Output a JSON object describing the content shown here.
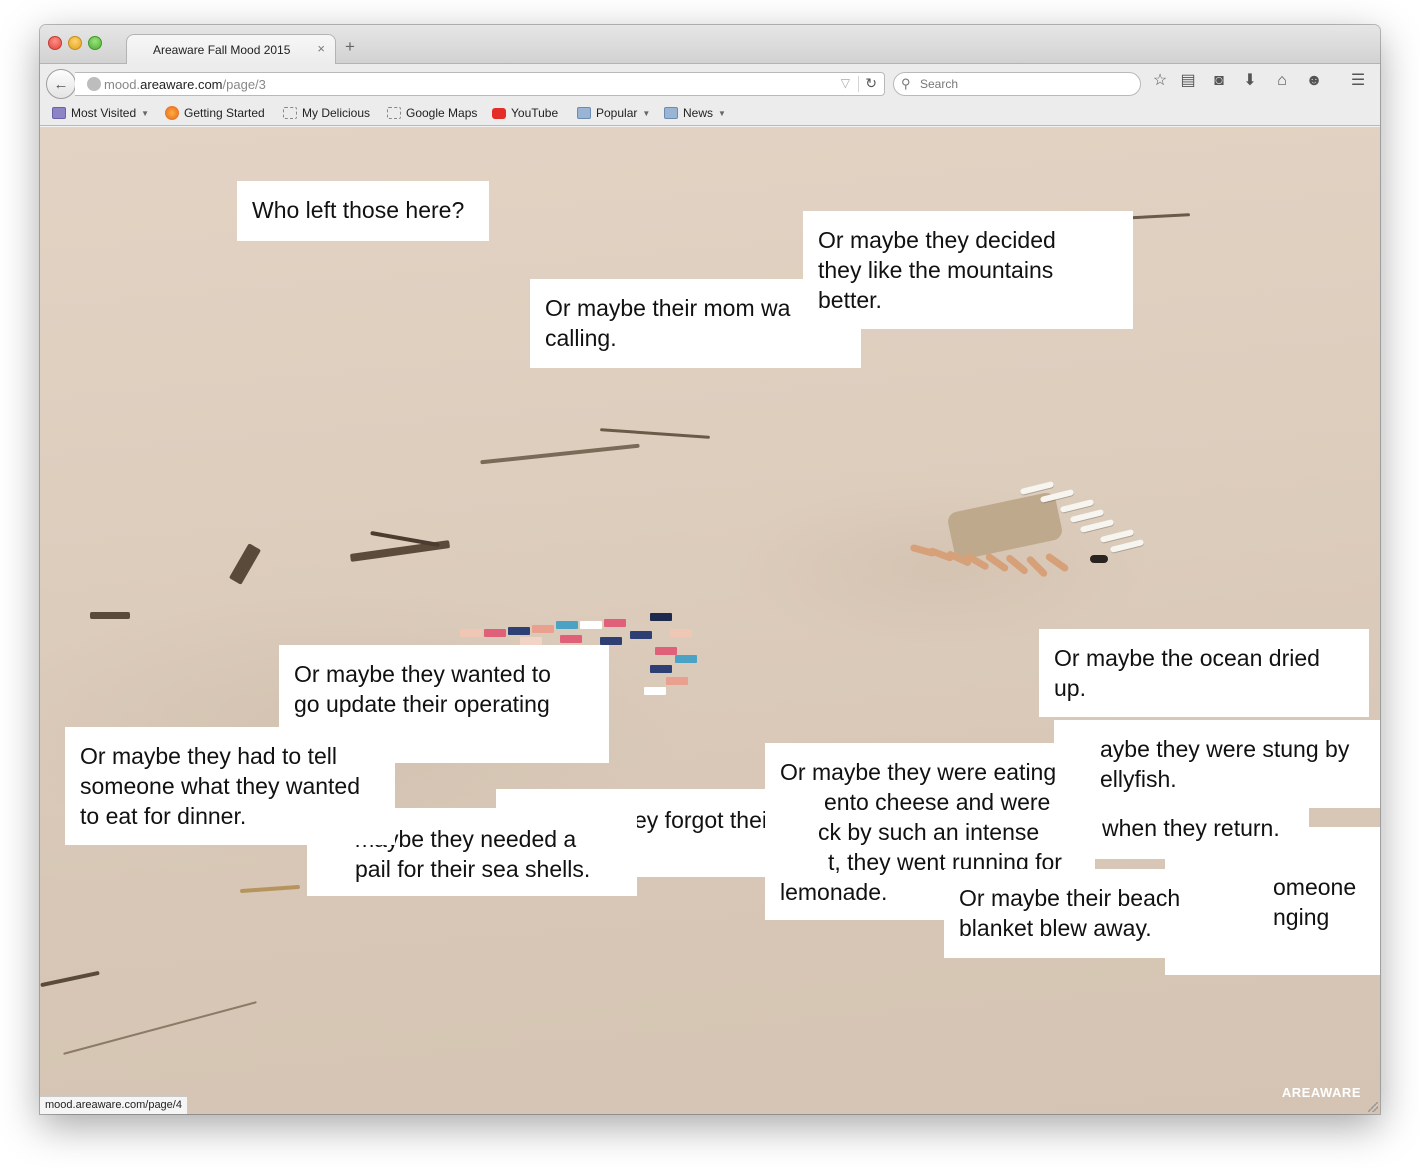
{
  "window": {
    "tab_title": "Areaware Fall Mood 2015",
    "tab_close": "×",
    "new_tab": "+"
  },
  "navbar": {
    "back_glyph": "←",
    "url_prefix": "mood.",
    "url_domain": "areaware.com",
    "url_path": "/page/3",
    "url_dropdown": "▽",
    "reload_glyph": "↻",
    "search_placeholder": "Search",
    "icons": [
      "star-icon",
      "reading-list-icon",
      "pocket-icon",
      "download-icon",
      "home-icon",
      "chat-icon",
      "menu-icon"
    ],
    "icon_glyphs": [
      "☆",
      "▤",
      "◙",
      "⬇",
      "⌂",
      "☻",
      "☰"
    ]
  },
  "bookmarks": [
    {
      "label": "Most Visited",
      "icon": "folder-purple",
      "caret": true
    },
    {
      "label": "Getting Started",
      "icon": "firefox",
      "caret": false
    },
    {
      "label": "My Delicious",
      "icon": "dashed-box",
      "caret": false
    },
    {
      "label": "Google Maps",
      "icon": "dashed-box",
      "caret": false
    },
    {
      "label": "YouTube",
      "icon": "youtube",
      "caret": false
    },
    {
      "label": "Popular",
      "icon": "folder",
      "caret": true
    },
    {
      "label": "News",
      "icon": "folder",
      "caret": true
    }
  ],
  "notes": [
    {
      "lines": [
        "Who left those here?"
      ]
    },
    {
      "lines": [
        "Or maybe they decided",
        "they like the mountains",
        "better."
      ]
    },
    {
      "lines": [
        "Or maybe their mom wa",
        "calling."
      ]
    },
    {
      "lines": [
        "Or maybe the ocean dried",
        "up."
      ]
    },
    {
      "lines": [
        "Or maybe they wanted to",
        "go update their operating"
      ]
    },
    {
      "lines": [
        "aybe they were stung by",
        "ellyfish."
      ]
    },
    {
      "lines": [
        "Or maybe they had to tell",
        "someone what they wanted",
        "to eat for dinner."
      ]
    },
    {
      "lines": [
        "Or maybe they were eating",
        "ento cheese and were",
        "ck by such an intense",
        "t, they went running for",
        "lemonade."
      ]
    },
    {
      "lines": [
        "ey forgot their"
      ]
    },
    {
      "lines": [
        "when they return."
      ]
    },
    {
      "lines": [
        "omeone",
        "nging"
      ]
    },
    {
      "lines": [
        "maybe they needed a",
        "pail for their sea shells."
      ]
    },
    {
      "lines": [
        "Or maybe their beach",
        "blanket blew away."
      ]
    }
  ],
  "brand": "AREAWARE",
  "status_text": "mood.areaware.com/page/4",
  "colors": {
    "tile_colors": [
      "#e0607a",
      "#2d3f73",
      "#f0c6b5",
      "#4aa3c4",
      "#e9a08f",
      "#ffffff"
    ]
  }
}
